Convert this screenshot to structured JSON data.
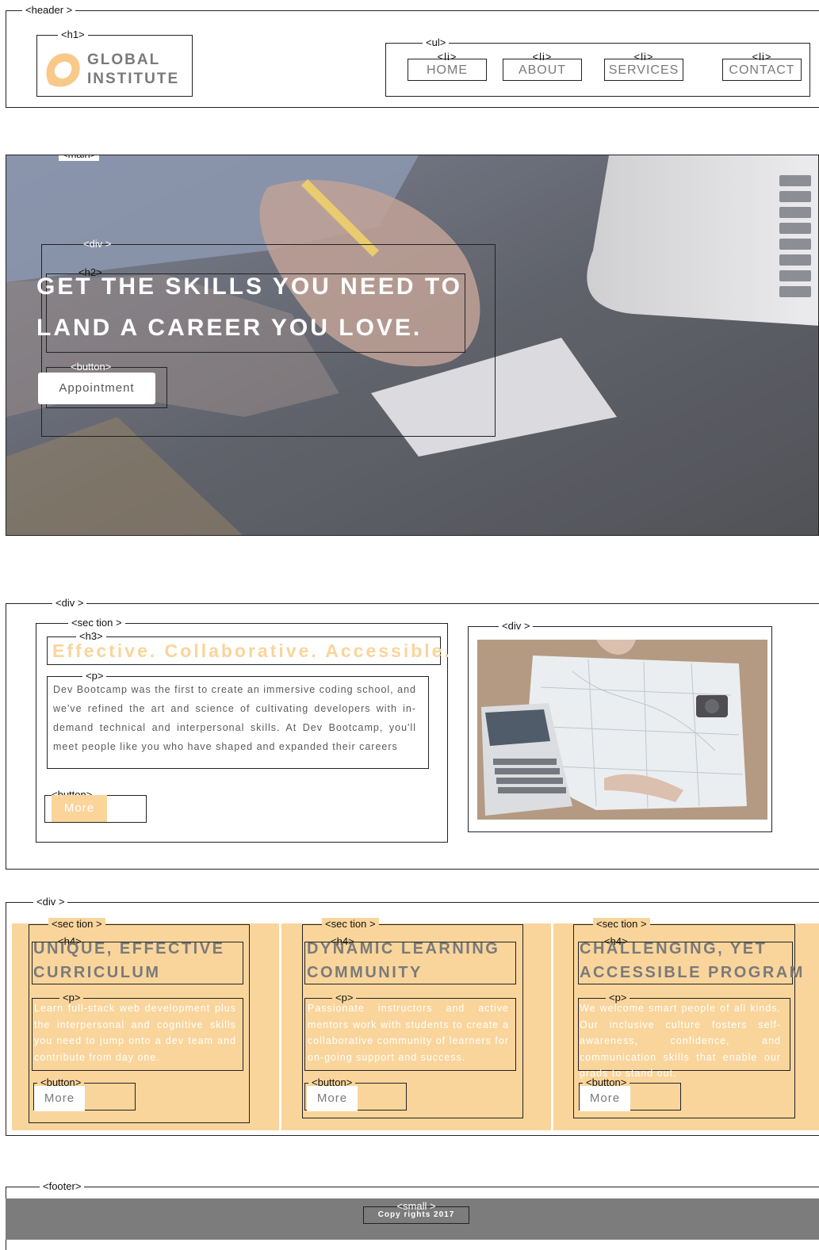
{
  "tags": {
    "header": "<header >",
    "h1": "<h1>",
    "ul": "<ul>",
    "li": "<li>",
    "main": "<main>",
    "div": "<div >",
    "h2": "<h2>",
    "button": "<button>",
    "section": "<sec tion >",
    "h3": "<h3>",
    "p": "<p>",
    "h4": "<h4>",
    "footer": "<footer>",
    "small": "<small >"
  },
  "header": {
    "logo_line1": "GLOBAL",
    "logo_line2": "INSTITUTE",
    "nav": [
      "HOME",
      "ABOUT",
      "SERVICES",
      "CONTACT"
    ]
  },
  "hero": {
    "title_line1": "GET THE SKILLS YOU NEED TO",
    "title_line2": "LAND A CAREER YOU LOVE.",
    "button": "Appointment"
  },
  "intro": {
    "heading": "Effective. Collaborative. Accessible.",
    "paragraph": "Dev Bootcamp was the first to create an immersive coding school, and we've refined the art and science of cultivating developers with in-demand technical and interpersonal skills. At Dev Bootcamp, you'll meet people like you who have shaped and expanded their careers",
    "button": "More"
  },
  "features": [
    {
      "title_line1": "UNIQUE, EFFECTIVE",
      "title_line2": "CURRICULUM",
      "text": "Learn full-stack web development plus the interpersonal and cognitive skills you need to jump onto a dev team and contribute from day one.",
      "button": "More"
    },
    {
      "title_line1": "DYNAMIC LEARNING",
      "title_line2": "COMMUNITY",
      "text": "Passionate instructors and active mentors work with students to create a collaborative community of learners for on-going support and success.",
      "button": "More"
    },
    {
      "title_line1": "CHALLENGING, YET",
      "title_line2": "ACCESSIBLE PROGRAM",
      "text": "We welcome smart people of all kinds. Our inclusive culture fosters self-awareness, confidence, and communication skills that enable our grads to stand out.",
      "button": "More"
    }
  ],
  "footer": {
    "copyright": "Copy rights 2017"
  },
  "colors": {
    "accent": "#f9d59c",
    "text_gray": "#7a7a7a",
    "footer_bg": "#7c7c7c",
    "outline": "#222222"
  }
}
